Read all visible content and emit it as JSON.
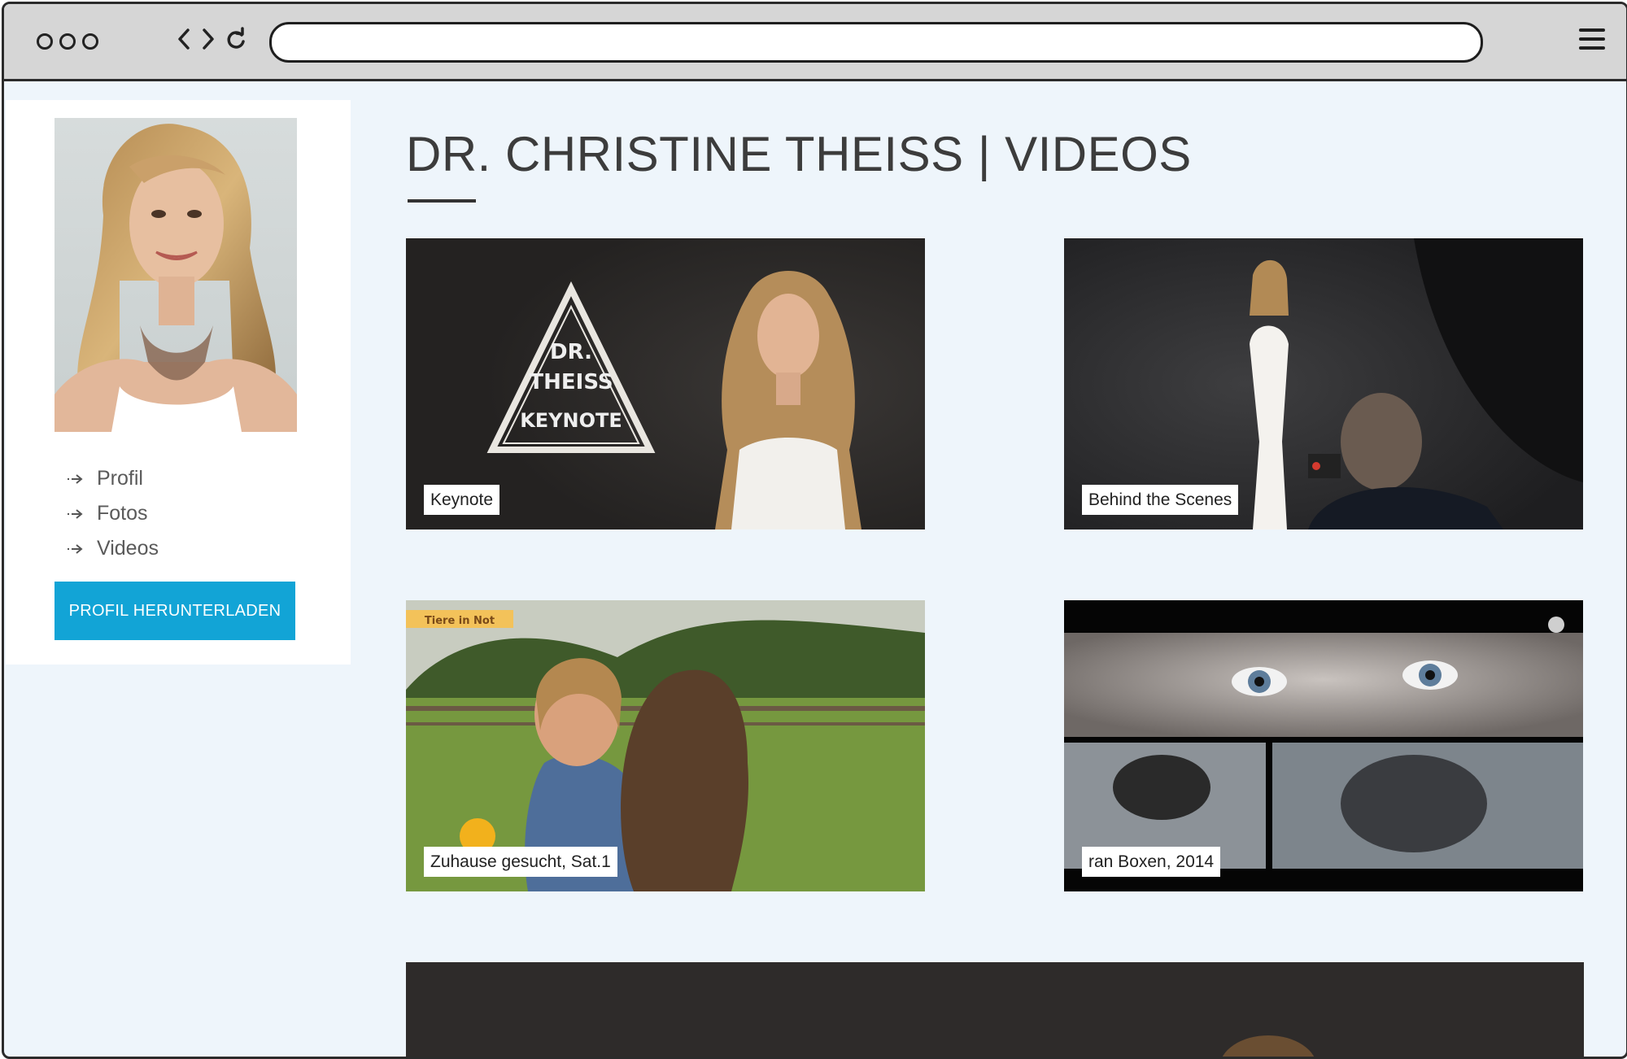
{
  "browser": {
    "url": "",
    "controls": [
      "back-icon",
      "forward-icon",
      "reload-icon"
    ],
    "menu_icon": "hamburger-menu-icon"
  },
  "sidebar": {
    "nav": [
      {
        "label": "Profil"
      },
      {
        "label": "Fotos"
      },
      {
        "label": "Videos"
      }
    ],
    "download_button": "PROFIL HERUNTERLADEN"
  },
  "main": {
    "title": "DR. CHRISTINE THEISS | VIDEOS",
    "videos": [
      {
        "caption": "Keynote",
        "thumb_text": [
          "DR.",
          "THEISS",
          "KEYNOTE"
        ]
      },
      {
        "caption": "Behind the Scenes"
      },
      {
        "caption": "Zuhause gesucht, Sat.1",
        "badge": "Tiere in Not"
      },
      {
        "caption": "ran Boxen, 2014"
      },
      {
        "caption": ""
      }
    ]
  },
  "colors": {
    "accent": "#12a4d6",
    "page_bg": "#eef5fb",
    "chrome_bg": "#d6d6d6",
    "title_text": "#3c3c3c"
  }
}
